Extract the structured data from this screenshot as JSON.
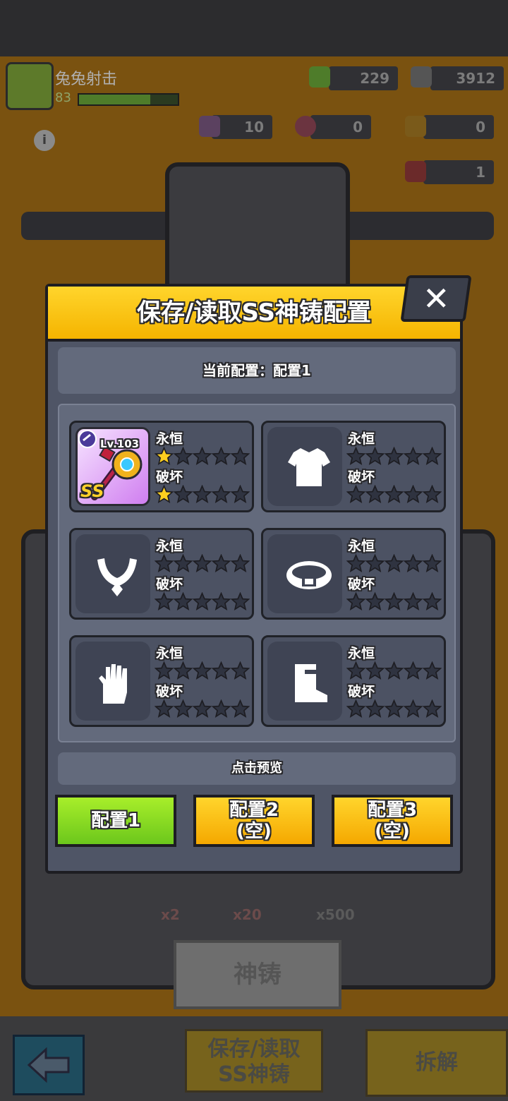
{
  "player": {
    "name": "兔兔射击",
    "level": "83",
    "exp_fraction": 0.72
  },
  "resources": [
    {
      "icon": "green-gem-icon",
      "value": "229"
    },
    {
      "icon": "grey-cube-icon",
      "value": "3912"
    },
    {
      "icon": "purple-shard-icon",
      "value": "10"
    },
    {
      "icon": "red-core-icon",
      "value": "0"
    },
    {
      "icon": "battery-icon",
      "value": "0"
    },
    {
      "icon": "red-crystal-icon",
      "value": "1"
    }
  ],
  "modal": {
    "title": "保存/读取SS神铸配置",
    "close_label": "✕",
    "current_config": "当前配置：配置1",
    "preview_label": "点击预览",
    "slots": [
      {
        "type": "weapon",
        "level": "Lv.103",
        "grade": "SS",
        "eternal_label": "永恒",
        "destroy_label": "破坏",
        "eternal_stars": 1,
        "destroy_stars": 1
      },
      {
        "type": "armor-icon",
        "eternal_label": "永恒",
        "destroy_label": "破坏",
        "eternal_stars": 0,
        "destroy_stars": 0
      },
      {
        "type": "necklace-icon",
        "eternal_label": "永恒",
        "destroy_label": "破坏",
        "eternal_stars": 0,
        "destroy_stars": 0
      },
      {
        "type": "belt-icon",
        "eternal_label": "永恒",
        "destroy_label": "破坏",
        "eternal_stars": 0,
        "destroy_stars": 0
      },
      {
        "type": "glove-icon",
        "eternal_label": "永恒",
        "destroy_label": "破坏",
        "eternal_stars": 0,
        "destroy_stars": 0
      },
      {
        "type": "boot-icon",
        "eternal_label": "永恒",
        "destroy_label": "破坏",
        "eternal_stars": 0,
        "destroy_stars": 0
      }
    ],
    "config_buttons": [
      {
        "line1": "配置1",
        "line2": "",
        "selected": true
      },
      {
        "line1": "配置2",
        "line2": "(空)",
        "selected": false
      },
      {
        "line1": "配置3",
        "line2": "(空)",
        "selected": false
      }
    ]
  },
  "background": {
    "cost_1": "x2",
    "cost_2": "x20",
    "cost_3": "x500",
    "forge_label": "神铸",
    "save_load_label_1": "保存/读取",
    "save_load_label_2": "SS神铸",
    "dismantle_label": "拆解"
  },
  "colors": {
    "header_yellow": "#ffd52c",
    "selected_green": "#8fdc22",
    "star_gold": "#ffcf1f",
    "star_empty": "#2f3340"
  }
}
